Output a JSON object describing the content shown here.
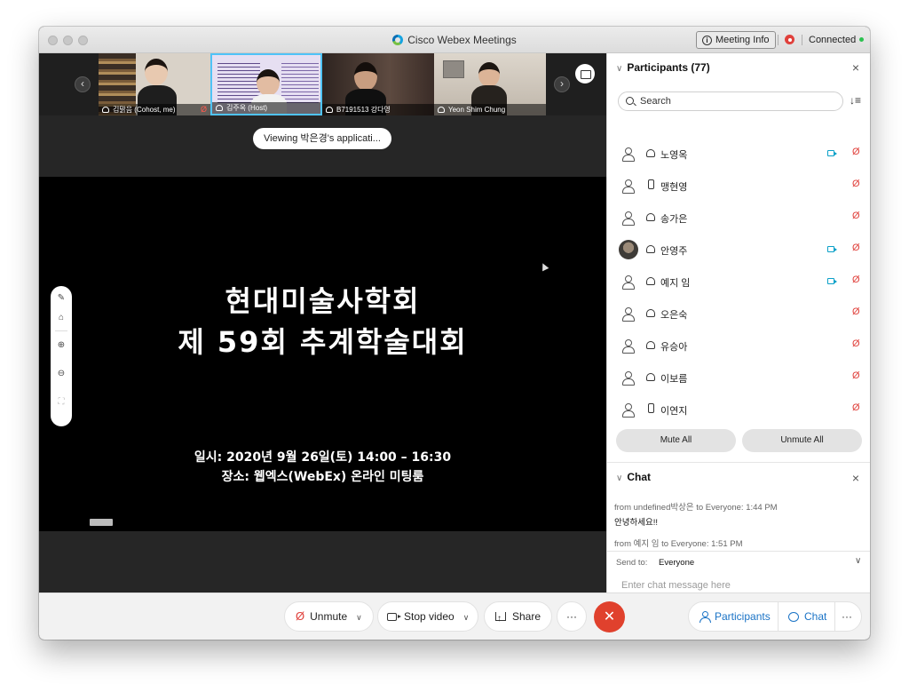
{
  "window": {
    "title": "Cisco Webex Meetings",
    "meeting_info_label": "Meeting Info",
    "connection_status": "Connected"
  },
  "video_strip": {
    "tiles": [
      {
        "label": "김맑음 (Cohost, me)",
        "muted": true
      },
      {
        "label": "김주옥 (Host)",
        "muted": false,
        "active_speaker": true
      },
      {
        "label": "B7191513 강다영",
        "muted": false
      },
      {
        "label": "Yeon Shim Chung",
        "muted": false
      }
    ]
  },
  "share": {
    "viewing_label": "Viewing 박은경's applicati...",
    "slide_title_line1": "현대미술사학회",
    "slide_title_line2": "제 59회 추계학술대회",
    "slide_date": "일시: 2020년 9월 26일(토) 14:00 – 16:30",
    "slide_place": "장소: 웹엑스(WebEx) 온라인 미팅룸"
  },
  "controls": {
    "unmute_label": "Unmute",
    "stop_video_label": "Stop video",
    "share_label": "Share",
    "more_label": "···",
    "end_label": "✕",
    "participants_label": "Participants",
    "chat_label": "Chat",
    "overflow_label": "···"
  },
  "participants_panel": {
    "title": "Participants (77)",
    "search_placeholder": "Search",
    "rows": [
      {
        "name": "노영옥",
        "device": "headset",
        "video": true,
        "muted": true
      },
      {
        "name": "맹현영",
        "device": "phone",
        "video": false,
        "muted": true
      },
      {
        "name": "송가은",
        "device": "headset",
        "video": false,
        "muted": true
      },
      {
        "name": "안영주",
        "device": "headset",
        "video": true,
        "muted": true,
        "avatar": "photo"
      },
      {
        "name": "예지 임",
        "device": "headset",
        "video": true,
        "muted": true
      },
      {
        "name": "오은숙",
        "device": "headset",
        "video": false,
        "muted": true
      },
      {
        "name": "유승아",
        "device": "headset",
        "video": false,
        "muted": true
      },
      {
        "name": "이보름",
        "device": "headset",
        "video": false,
        "muted": true
      },
      {
        "name": "이연지",
        "device": "phone",
        "video": false,
        "muted": true
      }
    ],
    "mute_all_label": "Mute All",
    "unmute_all_label": "Unmute All"
  },
  "chat_panel": {
    "title": "Chat",
    "messages": [
      {
        "meta": "from undefined박상은 to Everyone:   1:44  PM",
        "text": "안녕하세요!!"
      },
      {
        "meta": "from 예지 임 to Everyone:   1:51  PM",
        "text": ""
      }
    ],
    "send_to_label": "Send to:",
    "send_to_value": "Everyone",
    "input_placeholder": "Enter chat message here"
  },
  "colors": {
    "accent": "#1a73c6",
    "end_call": "#e0412d",
    "muted_red": "#e0403b",
    "active_speaker_border": "#4fc3f7"
  }
}
